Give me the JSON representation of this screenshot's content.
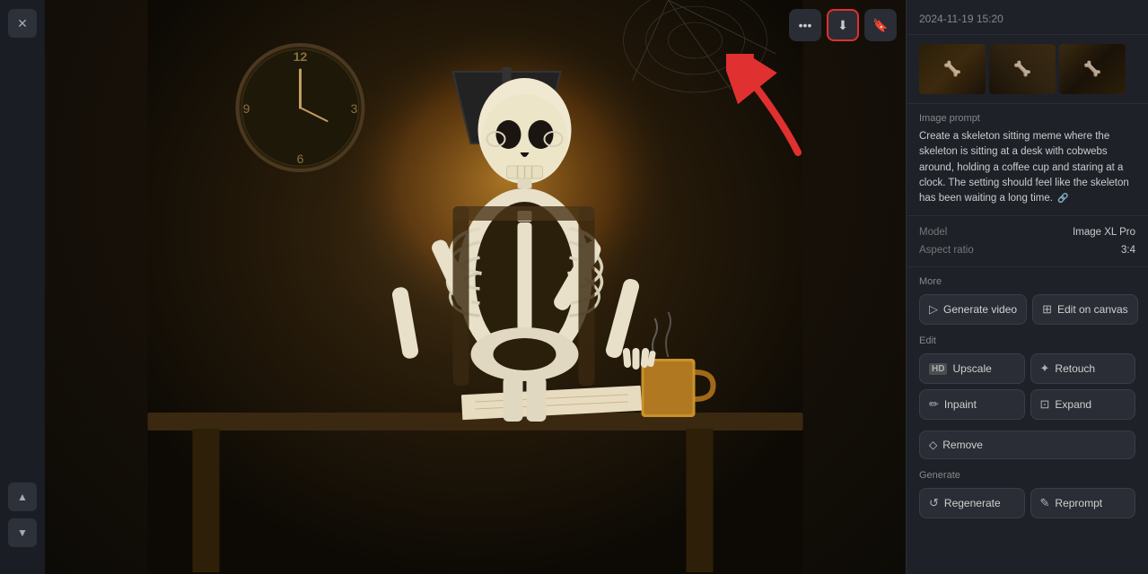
{
  "sidebar": {
    "close_label": "✕",
    "nav_up": "▲",
    "nav_down": "▼"
  },
  "toolbar": {
    "more_label": "•••",
    "download_label": "⬇",
    "bookmark_label": "🔖"
  },
  "right_panel": {
    "timestamp": "2024-11-19 15:20",
    "prompt_label": "Image prompt",
    "prompt_text": "Create a skeleton sitting meme where the skeleton is sitting at a desk with cobwebs around, holding a coffee cup and staring at a clock. The setting should feel like the skeleton has been waiting a long time.",
    "model_label": "Model",
    "model_value": "Image XL Pro",
    "aspect_label": "Aspect ratio",
    "aspect_value": "3:4",
    "more_section": "More",
    "edit_section": "Edit",
    "generate_section": "Generate",
    "buttons": {
      "generate_video": "Generate video",
      "edit_on_canvas": "Edit on canvas",
      "upscale": "Upscale",
      "retouch": "Retouch",
      "inpaint": "Inpaint",
      "expand": "Expand",
      "remove": "Remove",
      "regenerate": "Regenerate",
      "reprompt": "Reprompt"
    },
    "icons": {
      "video": "▷",
      "canvas": "⊞",
      "upscale": "HD",
      "retouch": "✦",
      "inpaint": "✏",
      "expand": "⊡",
      "remove": "◇",
      "regenerate": "↺",
      "reprompt": "✎"
    }
  }
}
